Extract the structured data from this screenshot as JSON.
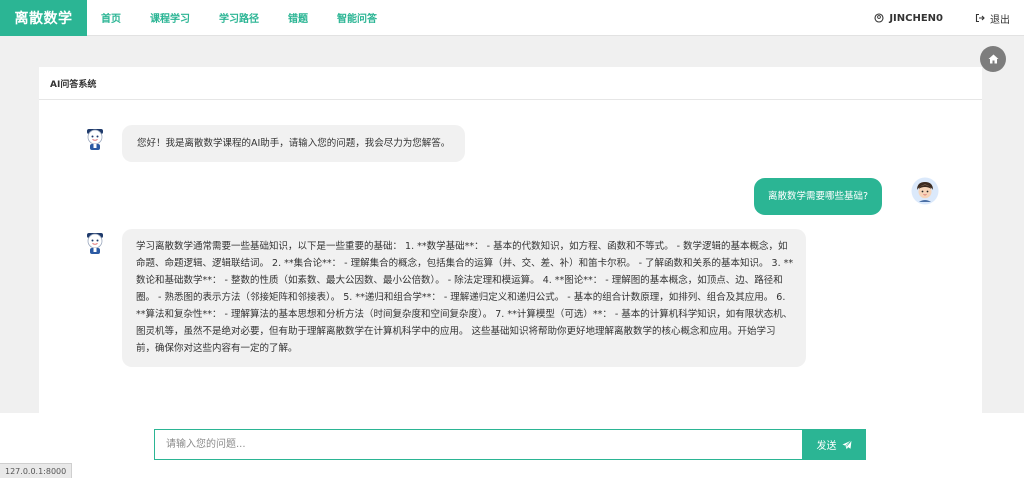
{
  "brand": "离散数学",
  "nav": [
    {
      "label": "首页"
    },
    {
      "label": "课程学习"
    },
    {
      "label": "学习路径"
    },
    {
      "label": "错题"
    },
    {
      "label": "智能问答"
    }
  ],
  "user": {
    "name": "JINCHEN0",
    "logout": "退出"
  },
  "panel": {
    "title": "AI问答系统"
  },
  "messages": [
    {
      "role": "assistant",
      "text": "您好！我是离散数学课程的AI助手，请输入您的问题，我会尽力为您解答。"
    },
    {
      "role": "user",
      "text": "离散数学需要哪些基础?"
    },
    {
      "role": "assistant",
      "text": "学习离散数学通常需要一些基础知识，以下是一些重要的基础： 1. **数学基础**： - 基本的代数知识，如方程、函数和不等式。 - 数学逻辑的基本概念，如命题、命题逻辑、逻辑联结词。 2. **集合论**： - 理解集合的概念，包括集合的运算（并、交、差、补）和笛卡尔积。 - 了解函数和关系的基本知识。 3. **数论和基础数学**： - 整数的性质（如素数、最大公因数、最小公倍数）。 - 除法定理和模运算。 4. **图论**： - 理解图的基本概念，如顶点、边、路径和圈。 - 熟悉图的表示方法（邻接矩阵和邻接表）。 5. **递归和组合学**： - 理解递归定义和递归公式。 - 基本的组合计数原理，如排列、组合及其应用。 6. **算法和复杂性**： - 理解算法的基本思想和分析方法（时间复杂度和空间复杂度）。 7. **计算模型（可选）**： - 基本的计算机科学知识，如有限状态机、图灵机等，虽然不是绝对必要，但有助于理解离散数学在计算机科学中的应用。 这些基础知识将帮助你更好地理解离散数学的核心概念和应用。开始学习前，确保你对这些内容有一定的了解。"
    }
  ],
  "input": {
    "placeholder": "请输入您的问题...",
    "value": ""
  },
  "send_label": "发送",
  "status_url": "127.0.0.1:8000",
  "colors": {
    "accent": "#2bb594",
    "bubble": "#f1f1f1"
  },
  "icons": {
    "user": "user-circle-icon",
    "logout": "sign-out-icon",
    "home": "home-icon",
    "send": "paper-plane-icon",
    "bot": "robot-avatar-icon",
    "user_avatar": "boy-avatar-icon"
  }
}
